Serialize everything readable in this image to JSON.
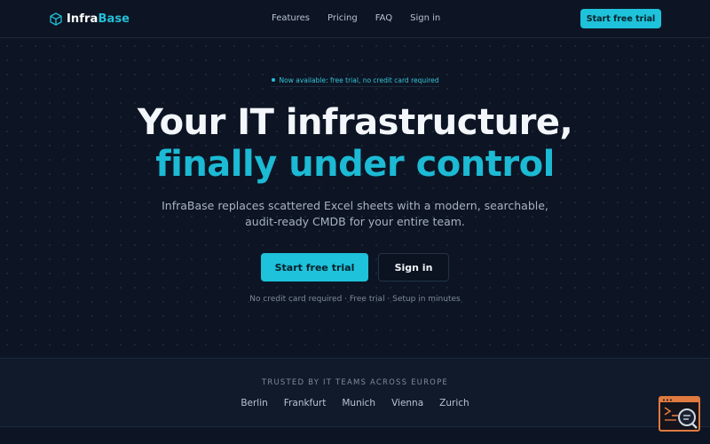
{
  "brand": {
    "name_part1": "Infra",
    "name_part2": "Base",
    "accent": "#1ec2da"
  },
  "nav": {
    "items": [
      {
        "label": "Features"
      },
      {
        "label": "Pricing"
      },
      {
        "label": "FAQ"
      },
      {
        "label": "Sign in"
      }
    ],
    "cta_label": "Start free trial"
  },
  "hero": {
    "badge": "Now available: free trial, no credit card required",
    "title_line1": "Your IT infrastructure,",
    "title_line2": "finally under control",
    "subtitle_line1": "InfraBase replaces scattered Excel sheets with a modern, searchable,",
    "subtitle_line2": "audit-ready CMDB for your entire team.",
    "primary_cta": "Start free trial",
    "secondary_cta": "Sign in",
    "note": "No credit card required · Free trial · Setup in minutes"
  },
  "trusted": {
    "title": "TRUSTED BY IT TEAMS ACROSS EUROPE",
    "cities": [
      "Berlin",
      "Frankfurt",
      "Munich",
      "Vienna",
      "Zurich"
    ]
  },
  "widget": {
    "icon": "inspect-widget-icon"
  }
}
